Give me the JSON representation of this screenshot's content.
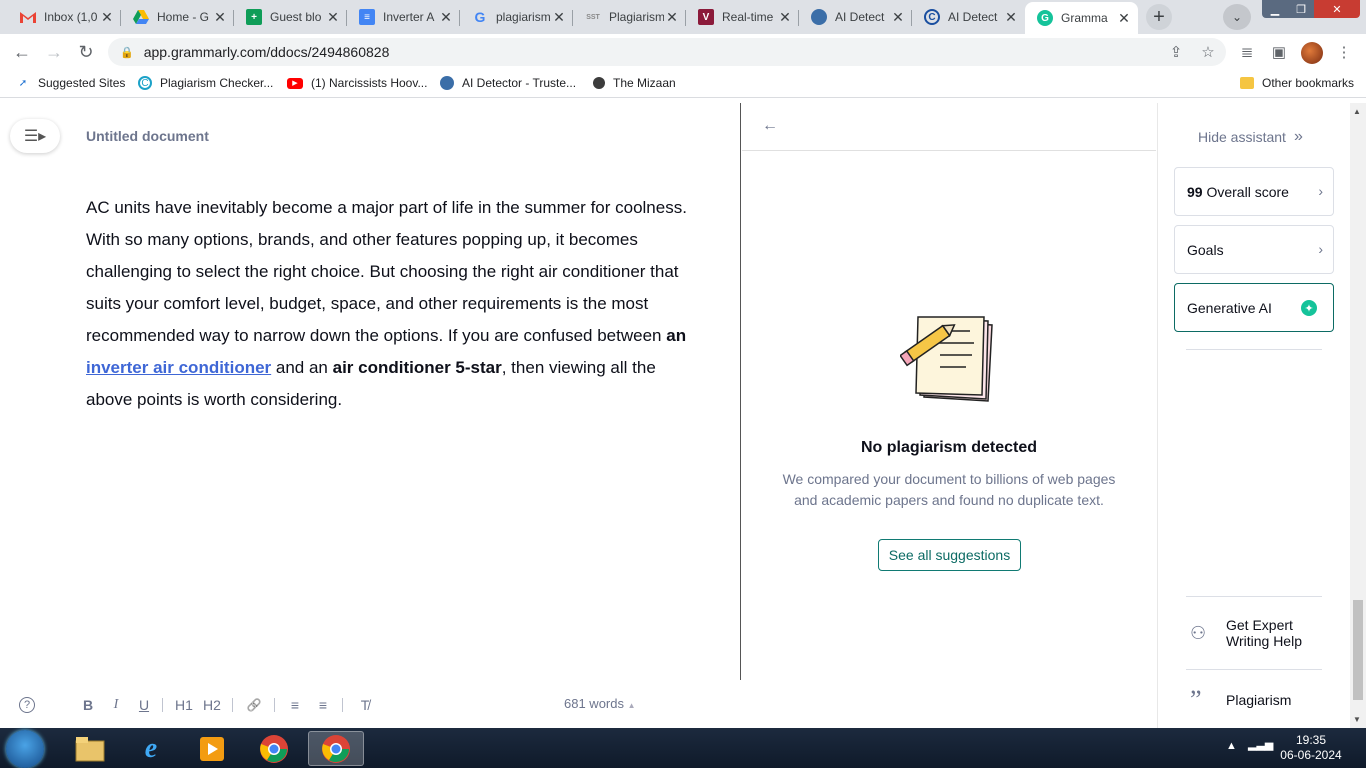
{
  "browser": {
    "tabs": [
      {
        "title": "Inbox (1,0",
        "icon": "gmail-icon",
        "color": "#ea4335"
      },
      {
        "title": "Home - G",
        "icon": "drive-icon",
        "color": "#fbbc04"
      },
      {
        "title": "Guest blo",
        "icon": "sheets-icon",
        "color": "#0f9d58"
      },
      {
        "title": "Inverter A",
        "icon": "docs-icon",
        "color": "#4285f4"
      },
      {
        "title": "plagiarism",
        "icon": "google-icon",
        "color": "#4285f4"
      },
      {
        "title": "Plagiarism",
        "icon": "sst-icon",
        "color": "#888888"
      },
      {
        "title": "Real-time",
        "icon": "app-icon",
        "color": "#8b1a3a"
      },
      {
        "title": "AI Detect",
        "icon": "ai-detector-icon",
        "color": "#3b6ea8"
      },
      {
        "title": "AI Detect",
        "icon": "copyleaks-icon",
        "color": "#1a4fa0"
      },
      {
        "title": "Gramma",
        "icon": "grammarly-icon",
        "color": "#15c39a"
      }
    ],
    "tab_close_glyph": "✕",
    "new_tab_glyph": "+",
    "url": "app.grammarly.com/ddocs/2494860828",
    "bookmarks": [
      {
        "label": "Suggested Sites",
        "icon": "sites-icon"
      },
      {
        "label": "Plagiarism Checker...",
        "icon": "plagiarism-checker-icon"
      },
      {
        "label": "(1) Narcissists Hoov...",
        "icon": "youtube-icon"
      },
      {
        "label": "AI Detector - Truste...",
        "icon": "ai-detector-icon"
      },
      {
        "label": "The Mizaan",
        "icon": "mizaan-icon"
      }
    ],
    "other_bookmarks": "Other bookmarks"
  },
  "editor": {
    "doc_title": "Untitled document",
    "paragraph": {
      "p1": "AC units have inevitably become a major part of life in the summer for coolness. With so many options, brands, and other features popping up, it becomes challenging to select the right choice. But choosing the right air conditioner that suits your comfort level, budget, space, and other requirements is the most recommended way to narrow down the options. If you are confused between ",
      "b1": "an",
      "space1": " ",
      "link": "inverter air conditioner",
      "p2": " and an ",
      "b2": "air conditioner 5-star",
      "p3": ", then viewing all the above points is worth considering."
    },
    "format_bar": {
      "help": "?",
      "bold": "B",
      "italic": "I",
      "underline": "U",
      "h1": "H1",
      "h2": "H2",
      "link": "🔗",
      "numbered": "≡",
      "bulleted": "≡",
      "clear": "T̸"
    },
    "word_count": "681 words",
    "word_count_arrow": "▲"
  },
  "plagiarism_panel": {
    "back": "←",
    "title": "No plagiarism detected",
    "description": "We compared your document to billions of web pages and academic papers and found no duplicate text.",
    "button": "See all suggestions"
  },
  "assistant": {
    "hide_label": "Hide assistant",
    "hide_glyph": "»",
    "score_value": "99",
    "score_label": "Overall score",
    "goals_label": "Goals",
    "generative_label": "Generative AI",
    "expert_label": "Get Expert Writing Help",
    "plagiarism_label": "Plagiarism"
  },
  "taskbar": {
    "time": "19:35",
    "date": "06-06-2024",
    "apps": [
      "explorer-icon",
      "internet-explorer-icon",
      "media-player-icon",
      "chrome-icon",
      "chrome-active-icon"
    ]
  },
  "colors": {
    "accent": "#0c6b64",
    "grammarly_green": "#15c39a",
    "link": "#3f67d6"
  }
}
